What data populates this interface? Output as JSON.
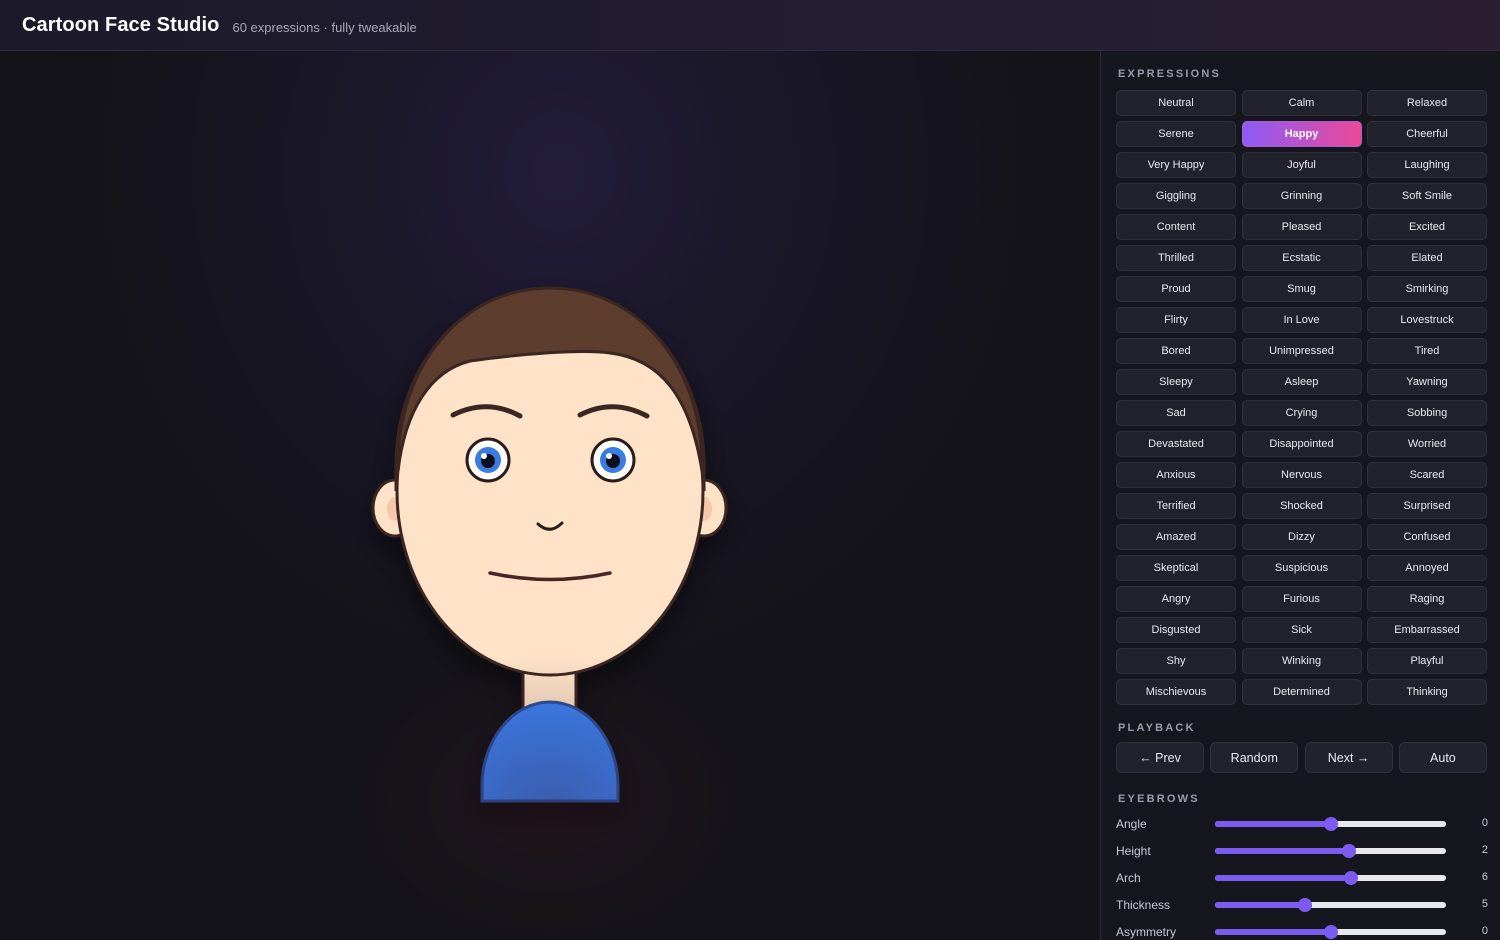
{
  "header": {
    "title": "Cartoon Face Studio",
    "subtitle": "60 expressions · fully tweakable"
  },
  "colors": {
    "accent_start": "#8b5cf6",
    "accent_end": "#ec4899",
    "slider": "#7c5cf0",
    "skin": "#ffe3c8",
    "hair": "#5c3d2e",
    "iris": "#3a7be0",
    "shirt": "#3b82f6"
  },
  "sections": {
    "expressions": "EXPRESSIONS",
    "playback": "PLAYBACK",
    "eyebrows": "EYEBROWS"
  },
  "expressions": [
    "Neutral",
    "Calm",
    "Relaxed",
    "Serene",
    "Happy",
    "Cheerful",
    "Very Happy",
    "Joyful",
    "Laughing",
    "Giggling",
    "Grinning",
    "Soft Smile",
    "Content",
    "Pleased",
    "Excited",
    "Thrilled",
    "Ecstatic",
    "Elated",
    "Proud",
    "Smug",
    "Smirking",
    "Flirty",
    "In Love",
    "Lovestruck",
    "Bored",
    "Unimpressed",
    "Tired",
    "Sleepy",
    "Asleep",
    "Yawning",
    "Sad",
    "Crying",
    "Sobbing",
    "Devastated",
    "Disappointed",
    "Worried",
    "Anxious",
    "Nervous",
    "Scared",
    "Terrified",
    "Shocked",
    "Surprised",
    "Amazed",
    "Dizzy",
    "Confused",
    "Skeptical",
    "Suspicious",
    "Annoyed",
    "Angry",
    "Furious",
    "Raging",
    "Disgusted",
    "Sick",
    "Embarrassed",
    "Shy",
    "Winking",
    "Playful",
    "Mischievous",
    "Determined",
    "Thinking"
  ],
  "active_expression": "Happy",
  "playback": {
    "prev": "← Prev",
    "random": "Random",
    "next": "Next →",
    "auto": "Auto"
  },
  "eyebrow_sliders": [
    {
      "label": "Angle",
      "value": "0",
      "fraction": 0.5
    },
    {
      "label": "Height",
      "value": "2",
      "fraction": 0.58
    },
    {
      "label": "Arch",
      "value": "6",
      "fraction": 0.59
    },
    {
      "label": "Thickness",
      "value": "5",
      "fraction": 0.39
    },
    {
      "label": "Asymmetry",
      "value": "0",
      "fraction": 0.5
    }
  ]
}
